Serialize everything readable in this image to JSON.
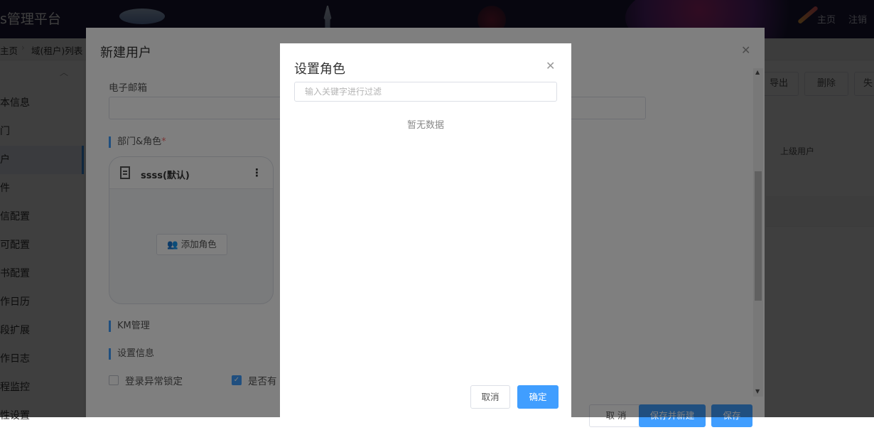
{
  "header": {
    "brand": "s管理平台",
    "links": [
      "主页",
      "注销"
    ]
  },
  "breadcrumb": [
    "主页",
    "域(租户)列表"
  ],
  "sidebar": {
    "items": [
      {
        "label": "本信息",
        "active": false
      },
      {
        "label": "门",
        "active": false
      },
      {
        "label": "户",
        "active": true
      },
      {
        "label": "件",
        "active": false
      },
      {
        "label": "信配置",
        "active": false
      },
      {
        "label": "可配置",
        "active": false
      },
      {
        "label": "书配置",
        "active": false
      },
      {
        "label": "作日历",
        "active": false
      },
      {
        "label": "段扩展",
        "active": false
      },
      {
        "label": "作日志",
        "active": false
      },
      {
        "label": "程监控",
        "active": false
      },
      {
        "label": "性设置",
        "active": false
      }
    ]
  },
  "background_page": {
    "buttons": [
      "导出",
      "删除",
      "失"
    ],
    "column_header": "上级用户"
  },
  "new_user_dialog": {
    "title": "新建用户",
    "email_label": "电子邮箱",
    "dept_role_section": "部门&角色",
    "required_mark": "*",
    "role_card": {
      "title": "ssss(默认)",
      "add_role_label": "添加角色"
    },
    "km_section": "KM管理",
    "settings_section": "设置信息",
    "checkboxes": [
      {
        "label": "登录异常锁定",
        "checked": false
      },
      {
        "label": "是否有",
        "checked": true
      }
    ],
    "footer": {
      "cancel": "取 消",
      "save_and_new": "保存并新建",
      "save": "保存"
    }
  },
  "set_role_dialog": {
    "title": "设置角色",
    "filter_placeholder": "输入关键字进行过滤",
    "empty_text": "暂无数据",
    "cancel_label": "取消",
    "confirm_label": "确定"
  },
  "colors": {
    "header_bg": "#1e1b3f",
    "primary": "#409eff",
    "mask": "rgba(0,0,0,0.5)"
  }
}
